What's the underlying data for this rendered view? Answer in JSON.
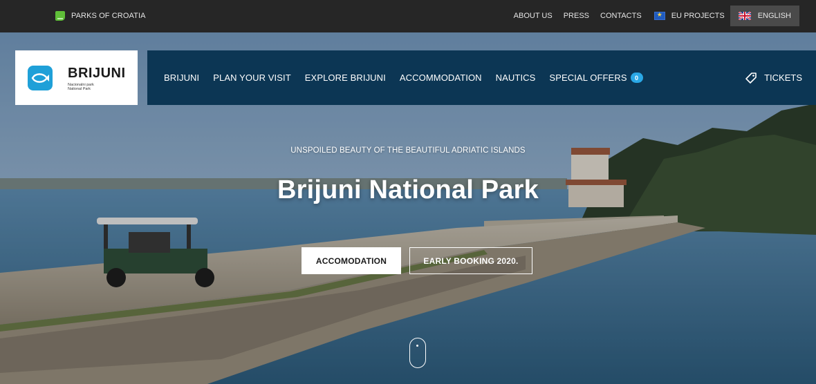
{
  "topbar": {
    "parks_label": "PARKS OF CROATIA",
    "links": [
      "ABOUT US",
      "PRESS",
      "CONTACTS"
    ],
    "eu_label": "EU PROJECTS",
    "language_label": "ENGLISH"
  },
  "logo": {
    "title": "BRIJUNI",
    "subtitle_line1": "Nacionalni park",
    "subtitle_line2": "National Park"
  },
  "nav": {
    "items": [
      "BRIJUNI",
      "PLAN YOUR VISIT",
      "EXPLORE BRIJUNI",
      "ACCOMMODATION",
      "NAUTICS"
    ],
    "special_offers_label": "SPECIAL OFFERS",
    "special_offers_count": "0",
    "tickets_label": "TICKETS"
  },
  "hero": {
    "tagline": "UNSPOILED BEAUTY OF THE BEAUTIFUL ADRIATIC ISLANDS",
    "title": "Brijuni National Park",
    "primary_button": "ACCOMODATION",
    "secondary_button": "EARLY BOOKING 2020."
  },
  "colors": {
    "topbar_bg": "#262626",
    "nav_bg": "#0c3654",
    "badge_bg": "#2aa8e6",
    "lang_bg": "#4a4a4a"
  },
  "icons": {
    "parks": "parks-of-croatia-icon",
    "eu": "eu-flag-icon",
    "language": "uk-flag-icon",
    "logo": "fish-logo-icon",
    "tickets": "ticket-tag-icon",
    "scroll": "scroll-mouse-icon"
  }
}
